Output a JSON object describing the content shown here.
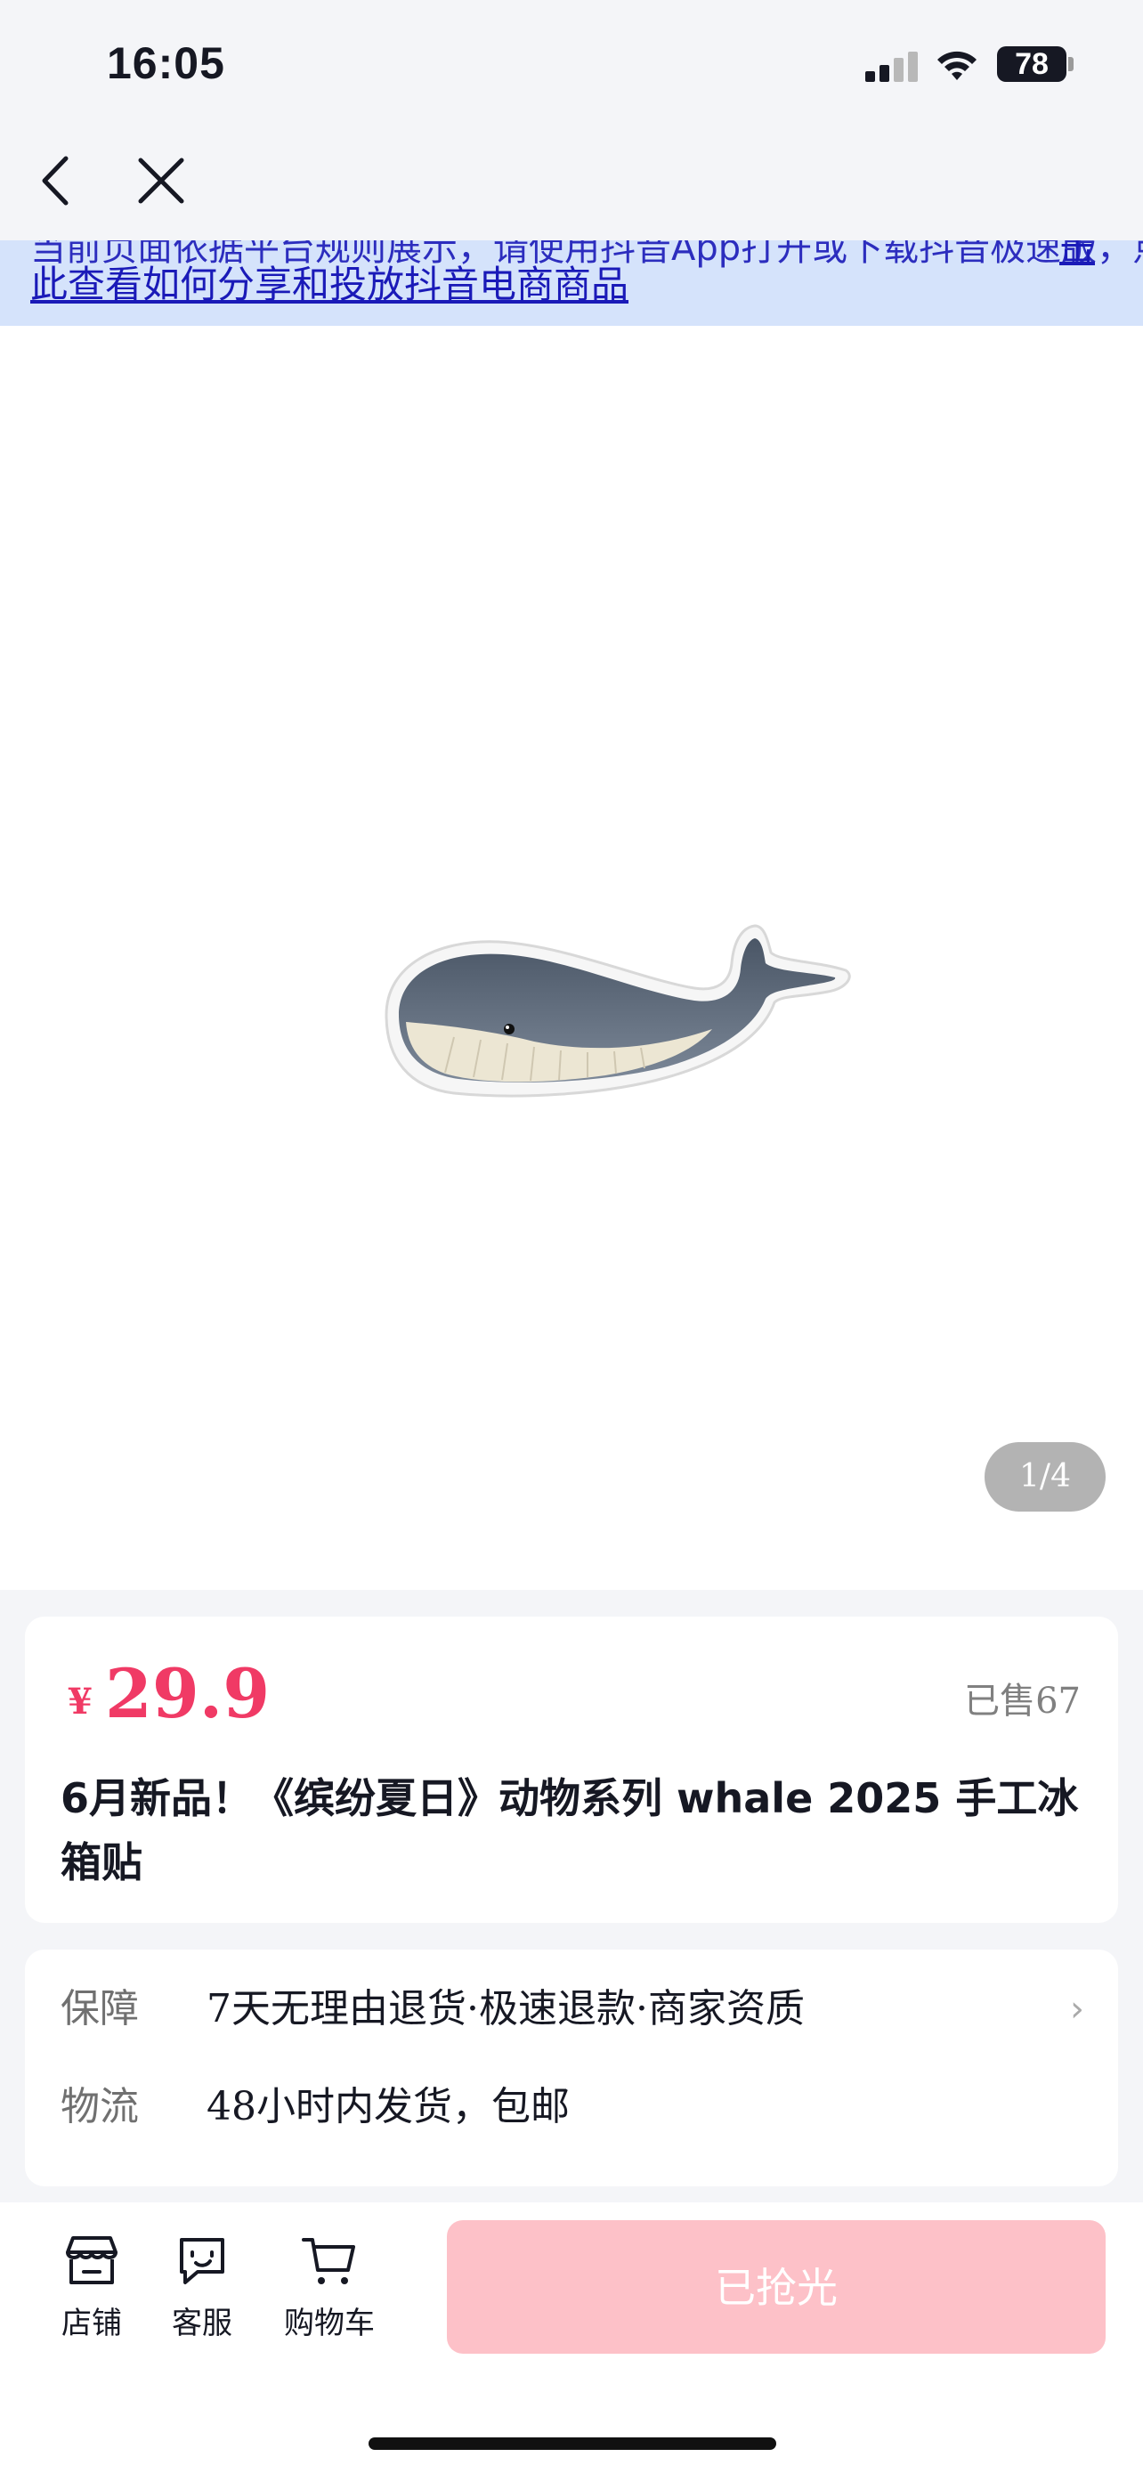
{
  "status_bar": {
    "time": "16:05",
    "battery": "78"
  },
  "banner": {
    "line1": "当前页面依据平台规则展示，请使用抖音App打开或下载抖音极速版，点",
    "line1_link_tail": "击",
    "line2": "此查看如何分享和投放抖音电商商品"
  },
  "gallery": {
    "page_indicator": "1/4"
  },
  "product": {
    "currency": "¥",
    "price": "29.9",
    "sold": "已售67",
    "title": "6月新品！《缤纷夏日》动物系列 whale 2025 手工冰箱贴"
  },
  "services": [
    {
      "label": "保障",
      "value": "7天无理由退货·极速退款·商家资质"
    },
    {
      "label": "物流",
      "value": "48小时内发货，包邮"
    }
  ],
  "bottom_bar": {
    "store": "店铺",
    "service": "客服",
    "cart": "购物车",
    "buy": "已抢光"
  },
  "colors": {
    "price": "#f03a65",
    "buy_disabled": "#fdc1c8",
    "banner_bg": "#d5e3fb",
    "link": "#1a1ab8"
  }
}
